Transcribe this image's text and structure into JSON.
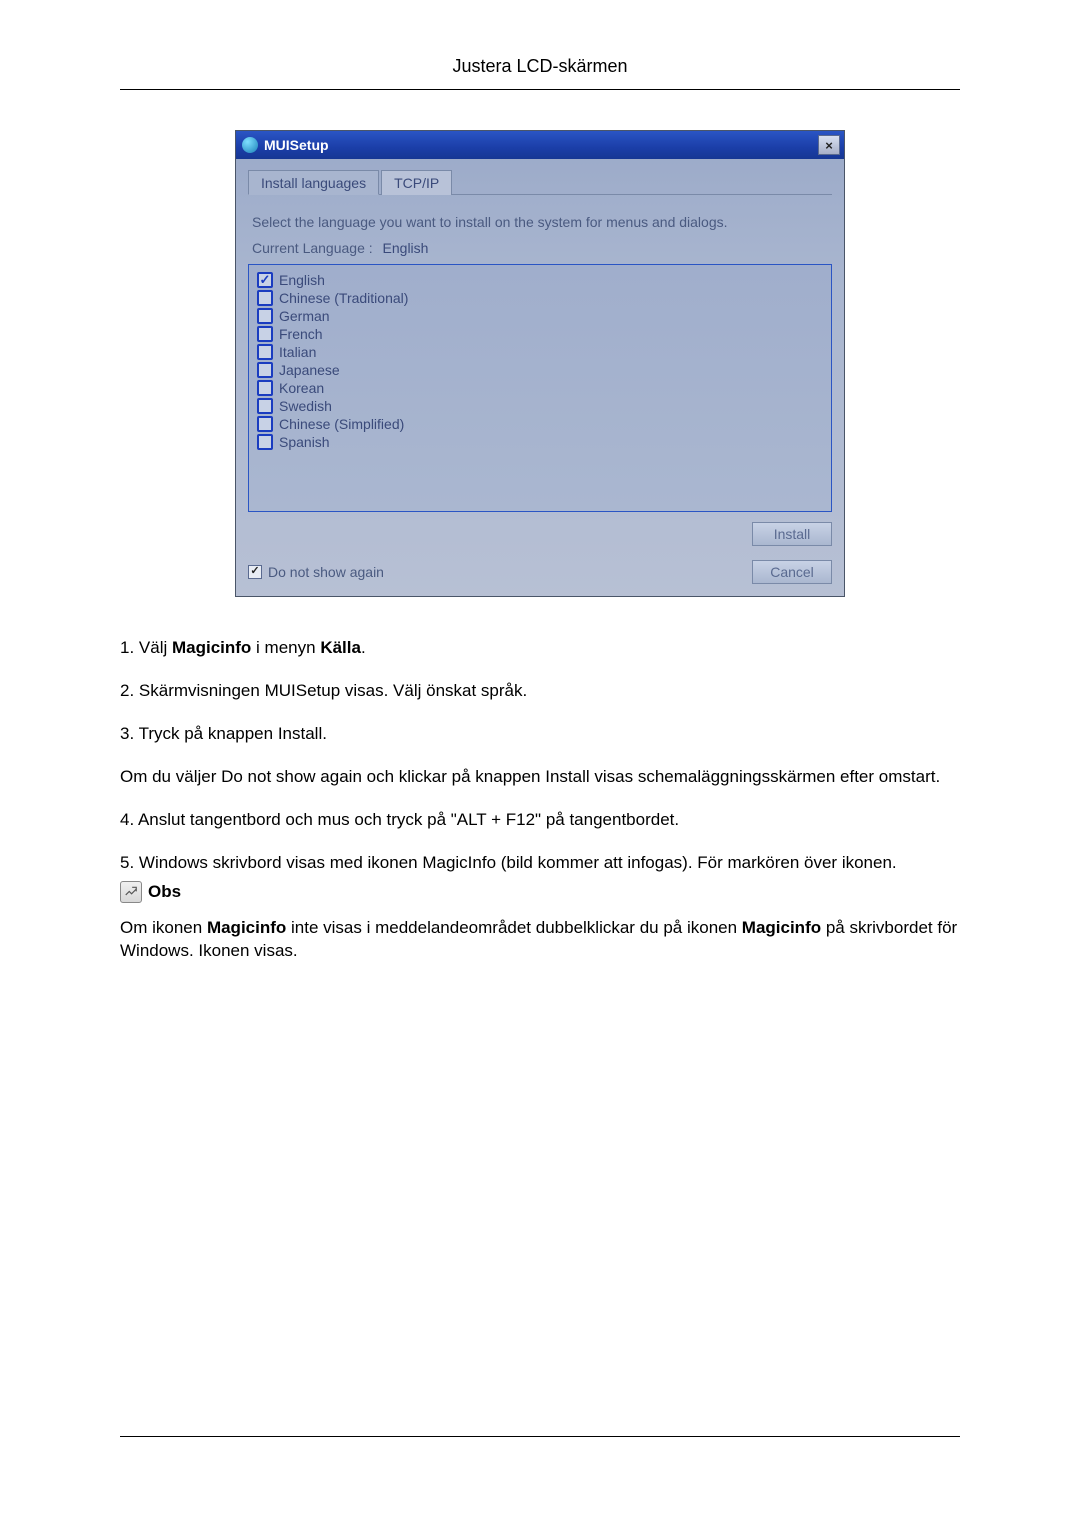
{
  "header": {
    "title": "Justera LCD-skärmen"
  },
  "dialog": {
    "title": "MUISetup",
    "closeGlyph": "×",
    "tabs": [
      {
        "label": "Install languages",
        "active": true
      },
      {
        "label": "TCP/IP",
        "active": false
      }
    ],
    "instruction": "Select the language you want to install on the system for menus and dialogs.",
    "currentLanguageLabel": "Current Language   :",
    "currentLanguageValue": "English",
    "languages": [
      {
        "label": "English",
        "checked": true
      },
      {
        "label": "Chinese (Traditional)",
        "checked": false
      },
      {
        "label": "German",
        "checked": false
      },
      {
        "label": "French",
        "checked": false
      },
      {
        "label": "Italian",
        "checked": false
      },
      {
        "label": "Japanese",
        "checked": false
      },
      {
        "label": "Korean",
        "checked": false
      },
      {
        "label": "Swedish",
        "checked": false
      },
      {
        "label": "Chinese (Simplified)",
        "checked": false
      },
      {
        "label": "Spanish",
        "checked": false
      }
    ],
    "installButton": "Install",
    "cancelButton": "Cancel",
    "doNotShow": {
      "label": "Do not show again",
      "checked": true
    }
  },
  "doc": {
    "p1_pre": "1. Välj ",
    "p1_b1": "Magicinfo",
    "p1_mid": " i menyn ",
    "p1_b2": "Källa",
    "p1_post": ".",
    "p2": "2. Skärmvisningen MUISetup visas. Välj önskat språk.",
    "p3": "3. Tryck på knappen Install.",
    "p4": "Om du väljer Do not show again och klickar på knappen Install visas schemaläggningsskärmen efter omstart.",
    "p5": "4. Anslut tangentbord och mus och tryck på \"ALT + F12\" på tangentbordet.",
    "p6": "5. Windows skrivbord visas med ikonen MagicInfo (bild kommer att infogas). För markören över ikonen.",
    "obsLabel": "Obs",
    "p7_pre": "Om ikonen ",
    "p7_b1": "Magicinfo",
    "p7_mid": "  inte visas i meddelandeområdet dubbelklickar du på ikonen ",
    "p7_b2": "Magicinfo",
    "p7_post": " på skrivbordet för Windows. Ikonen visas."
  }
}
